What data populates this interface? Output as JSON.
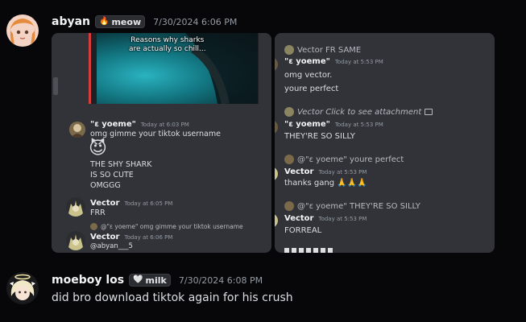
{
  "msg1": {
    "username": "abyan",
    "tag": {
      "icon": "🔥",
      "label": "meow"
    },
    "timestamp": "7/30/2024 6:06 PM"
  },
  "left_shot": {
    "video_caption_line1": "Reasons why sharks",
    "video_caption_line2": "are actually so chill...",
    "m1_name": "\"ɛ yoeme\"",
    "m1_ts": "Today at 6:03 PM",
    "m1_text": "omg gimme your tiktok username",
    "m1_emoji": "😈",
    "m1_line2": "THE SHY SHARK",
    "m1_line3": "IS SO CUTE",
    "m1_line4": "OMGGG",
    "m2_name": "Vector",
    "m2_ts": "Today at 6:05 PM",
    "m2_text": "FRR",
    "m3_reply": "@\"ɛ yoeme\" omg gimme your tiktok username",
    "m3_name": "Vector",
    "m3_ts": "Today at 6:06 PM",
    "m3_text": "@abyan___5"
  },
  "right_shot": {
    "r1_reply": "Vector FR SAME",
    "r1_name": "\"ɛ yoeme\"",
    "r1_ts": "Today at 5:53 PM",
    "r1_text1": "omg vector.",
    "r1_text2": "youre perfect",
    "r2_reply": "Vector Click to see attachment",
    "r2_name": "\"ɛ yoeme\"",
    "r2_ts": "Today at 5:53 PM",
    "r2_text": "THEY'RE SO SILLY",
    "r3_reply": "@\"ɛ yoeme\" youre perfect",
    "r3_name": "Vector",
    "r3_ts": "Today at 5:53 PM",
    "r3_text": "thanks gang 🙏🙏🙏",
    "r4_reply": "@\"ɛ yoeme\" THEY'RE SO SILLY",
    "r4_name": "Vector",
    "r4_ts": "Today at 5:53 PM",
    "r4_text": "FORREAL"
  },
  "msg2": {
    "username": "moeboy los",
    "tag": {
      "icon": "🤍",
      "label": "milk"
    },
    "timestamp": "7/30/2024 6:08 PM",
    "text": "did bro download tiktok again for his crush"
  }
}
